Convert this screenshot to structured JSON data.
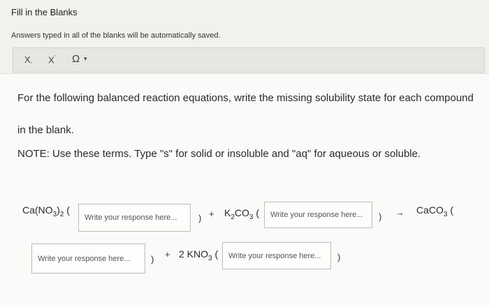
{
  "page": {
    "title": "Fill in the Blanks",
    "autosave_note": "Answers typed in all of the blanks will be automatically saved."
  },
  "toolbar": {
    "subscript_label": "X",
    "subscript_mark": ",",
    "superscript_label": "X",
    "superscript_mark": "'",
    "special_char_label": "Ω",
    "dropdown_caret": "▾"
  },
  "question": {
    "line1": "For the following balanced reaction equations, write the missing solubility state for each compound",
    "line2": "in the blank.",
    "note": "NOTE: Use these terms. Type \"s\" for solid or insoluble and \"aq\" for aqueous or soluble."
  },
  "equation": {
    "reactant1": {
      "base": "Ca(NO",
      "sub1": "3",
      "close": ")",
      "sub2": "2",
      "open": "("
    },
    "plus1": "+",
    "reactant2": {
      "base": "K",
      "sub1": "2",
      "mid": "CO",
      "sub2": "3",
      "open": "("
    },
    "close1": ")",
    "close2": ")",
    "arrow": "→",
    "product1": {
      "base": "CaCO",
      "sub": "3",
      "open": "("
    },
    "close3": ")",
    "plus2": "+",
    "product2": {
      "coef": "2 KNO",
      "sub": "3",
      "open": "("
    },
    "close4": ")"
  },
  "blanks": {
    "placeholder": "Write your response here...",
    "values": [
      "",
      "",
      "",
      ""
    ]
  }
}
